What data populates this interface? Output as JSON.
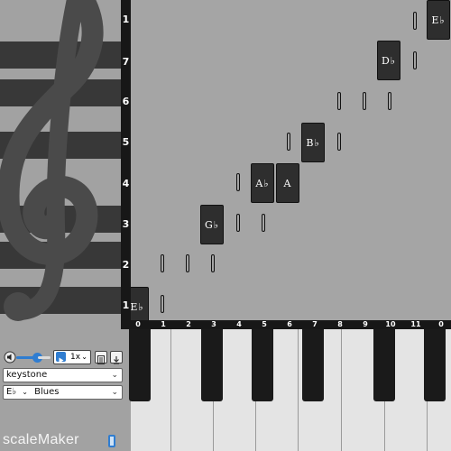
{
  "app_title": "scaleMaker",
  "row_labels": [
    "1",
    "7",
    "6",
    "5",
    "4",
    "3",
    "2",
    "1"
  ],
  "col_labels": [
    "0",
    "1",
    "2",
    "3",
    "4",
    "5",
    "6",
    "7",
    "8",
    "9",
    "10",
    "11",
    "0"
  ],
  "notes": {
    "eb_low": "E♭",
    "gb": "G♭",
    "ab": "A♭",
    "a": "A",
    "bb": "B♭",
    "db": "D♭",
    "eb_high": "E♭"
  },
  "controls": {
    "speed_value": "1x",
    "preset_value": "keystone",
    "key_value": "E♭",
    "scale_value": "Blues"
  },
  "colors": {
    "panel_dark": "#171717",
    "note_fill": "#2e2e2e",
    "accent_blue": "#2f7dd1"
  }
}
